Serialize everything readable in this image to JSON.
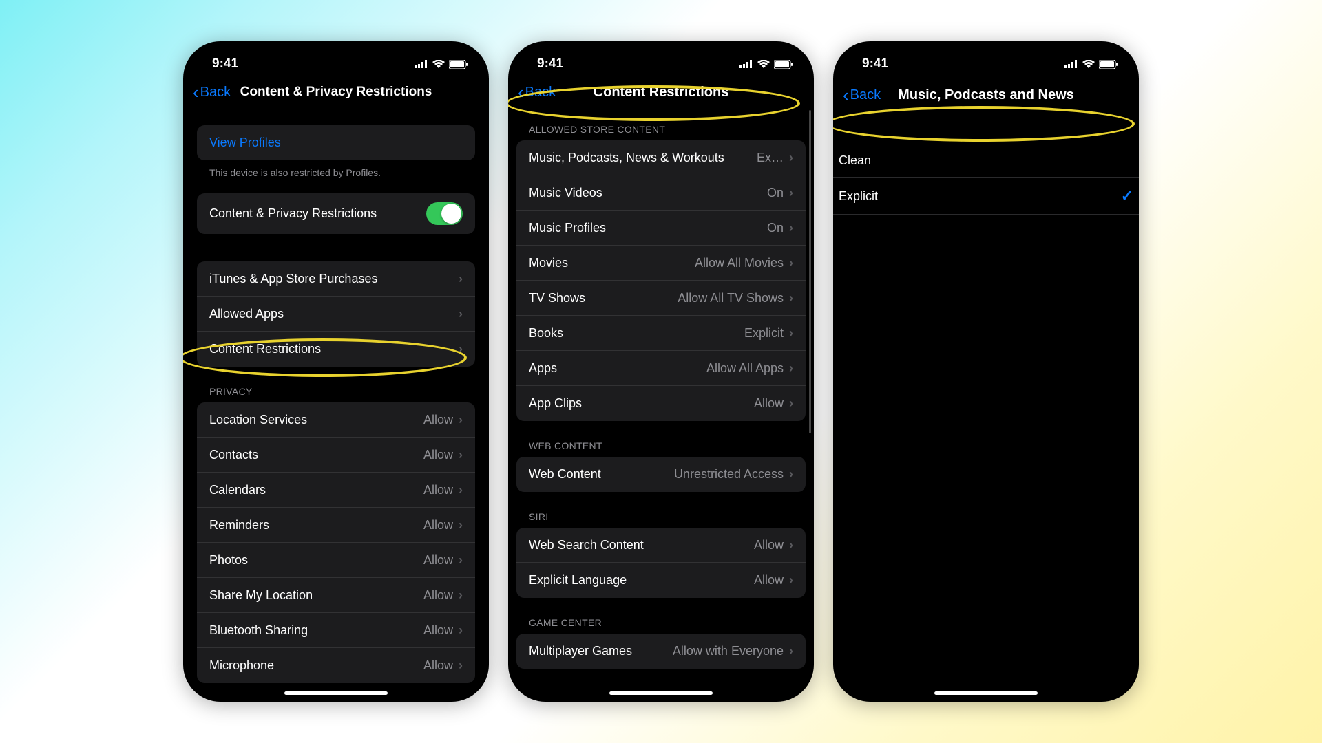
{
  "status": {
    "time": "9:41"
  },
  "nav": {
    "back": "Back"
  },
  "phone1": {
    "title": "Content & Privacy Restrictions",
    "viewProfiles": "View Profiles",
    "profilesNote": "This device is also restricted by Profiles.",
    "masterToggle": "Content & Privacy Restrictions",
    "rows": {
      "itunes": "iTunes & App Store Purchases",
      "allowedApps": "Allowed Apps",
      "contentRestrictions": "Content Restrictions"
    },
    "privacyHeader": "PRIVACY",
    "privacy": [
      {
        "label": "Location Services",
        "value": "Allow"
      },
      {
        "label": "Contacts",
        "value": "Allow"
      },
      {
        "label": "Calendars",
        "value": "Allow"
      },
      {
        "label": "Reminders",
        "value": "Allow"
      },
      {
        "label": "Photos",
        "value": "Allow"
      },
      {
        "label": "Share My Location",
        "value": "Allow"
      },
      {
        "label": "Bluetooth Sharing",
        "value": "Allow"
      },
      {
        "label": "Microphone",
        "value": "Allow"
      }
    ]
  },
  "phone2": {
    "title": "Content Restrictions",
    "sections": {
      "allowed": "ALLOWED STORE CONTENT",
      "web": "WEB CONTENT",
      "siri": "SIRI",
      "gamecenter": "GAME CENTER"
    },
    "allowed": [
      {
        "label": "Music, Podcasts, News & Workouts",
        "value": "Ex…"
      },
      {
        "label": "Music Videos",
        "value": "On"
      },
      {
        "label": "Music Profiles",
        "value": "On"
      },
      {
        "label": "Movies",
        "value": "Allow All Movies"
      },
      {
        "label": "TV Shows",
        "value": "Allow All TV Shows"
      },
      {
        "label": "Books",
        "value": "Explicit"
      },
      {
        "label": "Apps",
        "value": "Allow All Apps"
      },
      {
        "label": "App Clips",
        "value": "Allow"
      }
    ],
    "web": [
      {
        "label": "Web Content",
        "value": "Unrestricted Access"
      }
    ],
    "siri": [
      {
        "label": "Web Search Content",
        "value": "Allow"
      },
      {
        "label": "Explicit Language",
        "value": "Allow"
      }
    ],
    "gamecenter": [
      {
        "label": "Multiplayer Games",
        "value": "Allow with Everyone"
      }
    ]
  },
  "phone3": {
    "title": "Music, Podcasts and News",
    "options": [
      {
        "label": "Clean",
        "selected": false
      },
      {
        "label": "Explicit",
        "selected": true
      }
    ]
  }
}
